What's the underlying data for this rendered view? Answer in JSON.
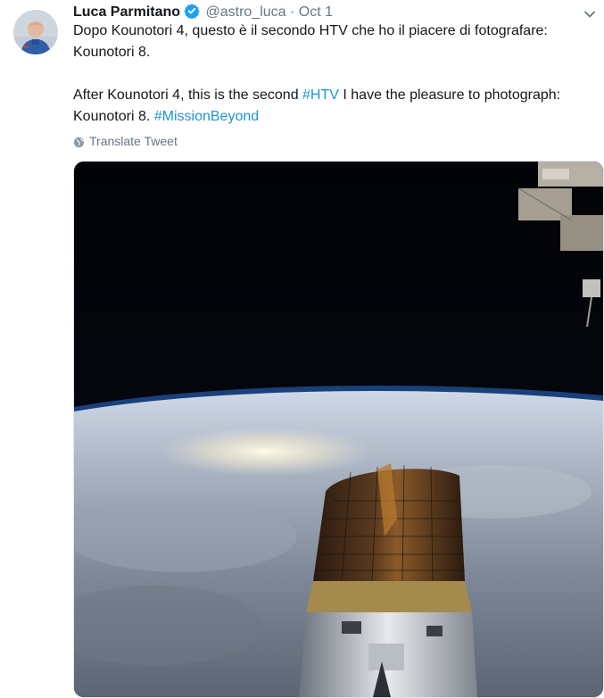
{
  "tweet": {
    "author_name": "Luca Parmitano",
    "handle": "@astro_luca",
    "separator": "·",
    "time": "Oct 1",
    "text_it": "Dopo Kounotori 4, questo è il secondo HTV che ho il piacere di fotografare: Kounotori 8.",
    "text_en_1": "After Kounotori 4, this is the second ",
    "hashtag_1": "#HTV",
    "text_en_2": " I have the pleasure to photograph: Kounotori 8. ",
    "hashtag_2": "#MissionBeyond",
    "translate_label": "Translate Tweet"
  },
  "icons": {
    "verified": "verified-badge-icon",
    "caret": "chevron-down-icon",
    "translate": "globe-icon"
  },
  "colors": {
    "link": "#1b95e0",
    "verified": "#1da1f2",
    "muted": "#657786",
    "text": "#14171a"
  }
}
